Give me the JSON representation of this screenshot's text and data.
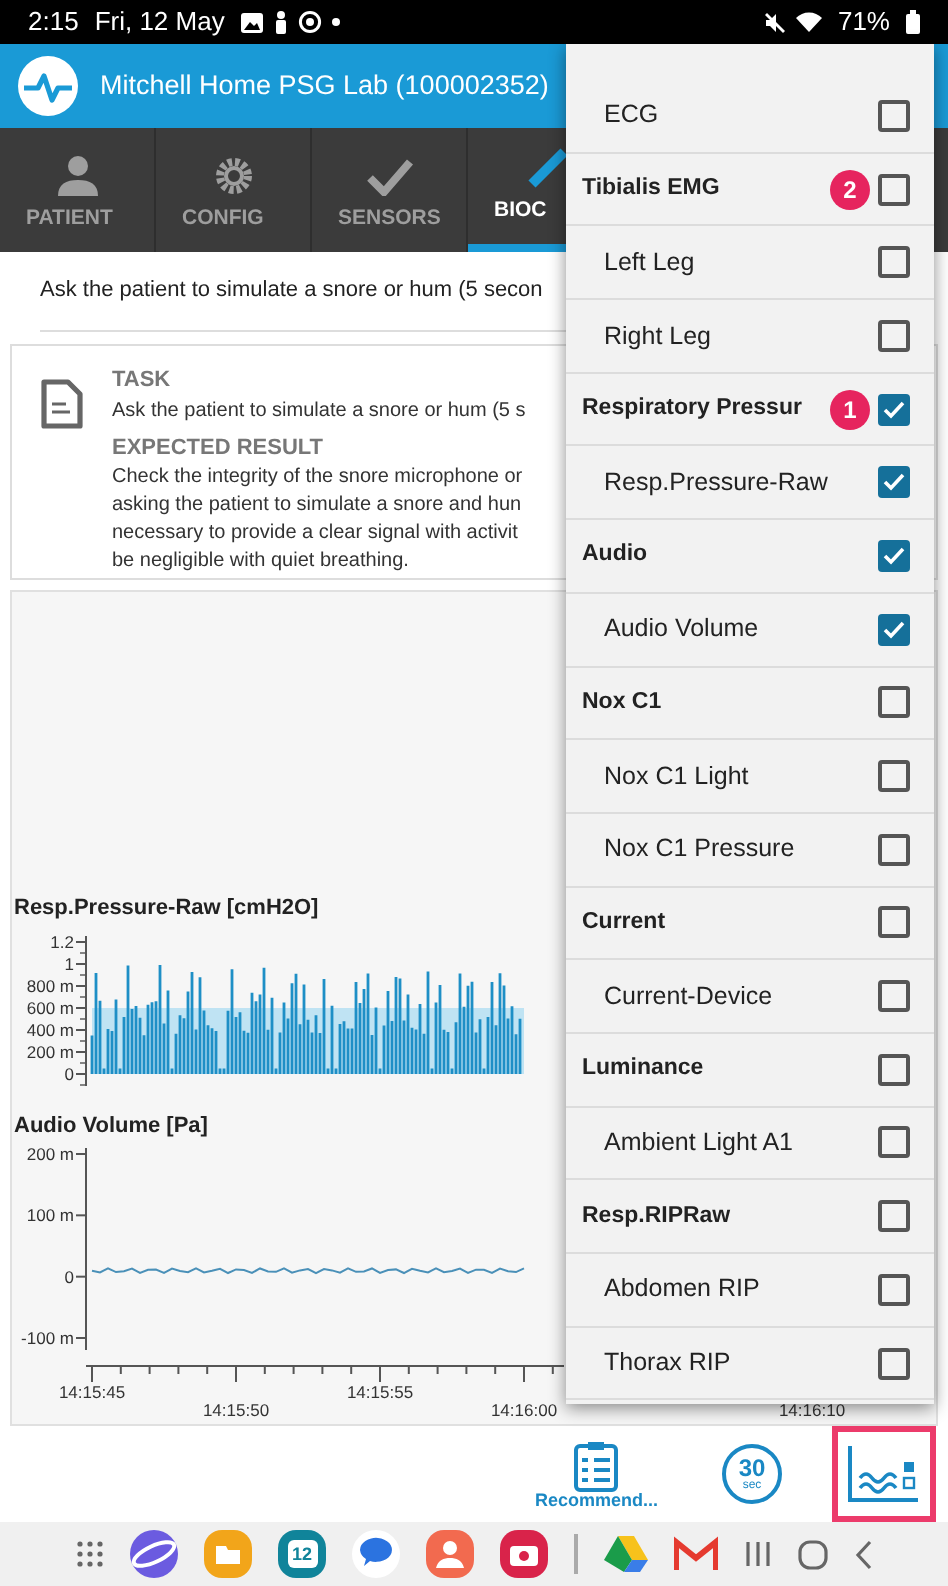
{
  "status_bar": {
    "time": "2:15",
    "date": "Fri, 12 May",
    "battery": "71%"
  },
  "app_bar": {
    "title": "Mitchell Home PSG Lab (100002352)"
  },
  "tabs": [
    {
      "label": "PATIENT",
      "selected": false
    },
    {
      "label": "CONFIG",
      "selected": false
    },
    {
      "label": "SENSORS",
      "selected": false
    },
    {
      "label": "BIOC",
      "selected": true
    }
  ],
  "instruction": "Ask the patient to simulate a snore or hum (5 secon",
  "task_card": {
    "task_heading": "TASK",
    "task": "Ask the patient to simulate a snore or hum (5 s",
    "expected_heading": "EXPECTED RESULT",
    "expected": "Check the integrity of the snore microphone or\nasking the patient to simulate a snore and hun\nnecessary to provide a clear signal with activit\nbe negligible with quiet breathing."
  },
  "charts": [
    {
      "title": "Resp.Pressure-Raw [cmH2O]",
      "kind": "bars",
      "y_labels": [
        "1.2",
        "1",
        "800 m",
        "600 m",
        "400 m",
        "200 m",
        "0"
      ]
    },
    {
      "title": "Audio Volume [Pa]",
      "kind": "line",
      "y_labels": [
        "200 m",
        "100 m",
        "0",
        "-100 m"
      ]
    }
  ],
  "x_labels": [
    "14:15:45",
    "14:15:50",
    "14:15:55",
    "14:16:00",
    "14:16:10"
  ],
  "channel_menu": [
    {
      "label": "ECG",
      "kind": "channel",
      "checked": false
    },
    {
      "label": "Tibialis EMG",
      "kind": "group",
      "checked": false,
      "badge": "2"
    },
    {
      "label": "Left Leg",
      "kind": "channel",
      "checked": false
    },
    {
      "label": "Right Leg",
      "kind": "channel",
      "checked": false
    },
    {
      "label": "Respiratory Pressur",
      "kind": "group",
      "checked": true,
      "badge": "1"
    },
    {
      "label": "Resp.Pressure-Raw",
      "kind": "channel",
      "checked": true
    },
    {
      "label": "Audio",
      "kind": "group",
      "checked": true
    },
    {
      "label": "Audio Volume",
      "kind": "channel",
      "checked": true
    },
    {
      "label": "Nox C1",
      "kind": "group",
      "checked": false
    },
    {
      "label": "Nox C1 Light",
      "kind": "channel",
      "checked": false
    },
    {
      "label": "Nox C1 Pressure",
      "kind": "channel",
      "checked": false
    },
    {
      "label": "Current",
      "kind": "group",
      "checked": false
    },
    {
      "label": "Current-Device",
      "kind": "channel",
      "checked": false
    },
    {
      "label": "Luminance",
      "kind": "group",
      "checked": false
    },
    {
      "label": "Ambient Light A1",
      "kind": "channel",
      "checked": false
    },
    {
      "label": "Resp.RIPRaw",
      "kind": "group",
      "checked": false
    },
    {
      "label": "Abdomen RIP",
      "kind": "channel",
      "checked": false
    },
    {
      "label": "Thorax RIP",
      "kind": "channel",
      "checked": false
    }
  ],
  "toolbar": [
    {
      "kind": "recommend",
      "label": "Recommend...",
      "highlighted": false
    },
    {
      "kind": "timer",
      "value": "30",
      "unit": "sec",
      "highlighted": false
    },
    {
      "kind": "signals",
      "highlighted": true
    }
  ],
  "dock": [
    {
      "kind": "grid"
    },
    {
      "kind": "internet"
    },
    {
      "kind": "files"
    },
    {
      "kind": "calendar",
      "text": "12"
    },
    {
      "kind": "messages"
    },
    {
      "kind": "contacts"
    },
    {
      "kind": "camera"
    },
    {
      "kind": "separator"
    },
    {
      "kind": "drive"
    },
    {
      "kind": "gmail"
    },
    {
      "kind": "recents"
    },
    {
      "kind": "home"
    },
    {
      "kind": "back"
    }
  ]
}
